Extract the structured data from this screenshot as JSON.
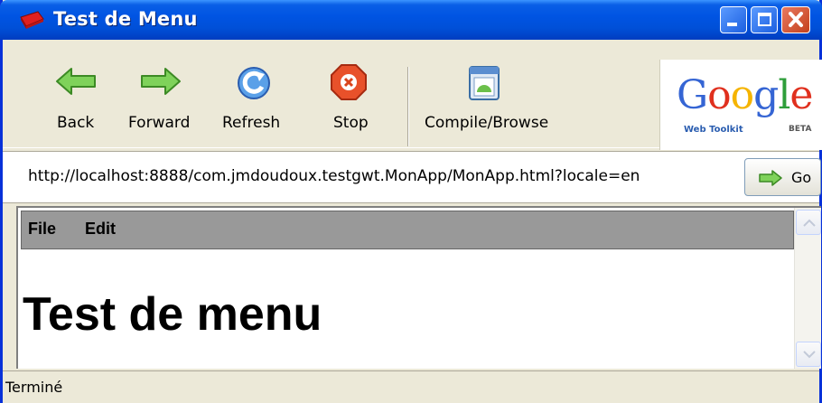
{
  "window": {
    "title": "Test de Menu"
  },
  "toolbar": {
    "back_label": "Back",
    "forward_label": "Forward",
    "refresh_label": "Refresh",
    "stop_label": "Stop",
    "compile_label": "Compile/Browse"
  },
  "logo": {
    "google": "Google",
    "web_toolkit": "Web Toolkit",
    "beta": "BETA"
  },
  "address": {
    "url": "http://localhost:8888/com.jmdoudoux.testgwt.MonApp/MonApp.html?locale=en",
    "go_label": "Go"
  },
  "page": {
    "menu": [
      "File",
      "Edit"
    ],
    "heading": "Test de menu"
  },
  "status": {
    "text": "Terminé"
  },
  "colors": {
    "titlebar": "#0054e3",
    "chrome": "#ece9d8",
    "menubar": "#999999",
    "arrow_green": "#6cc04a",
    "stop_red": "#d9441c"
  }
}
